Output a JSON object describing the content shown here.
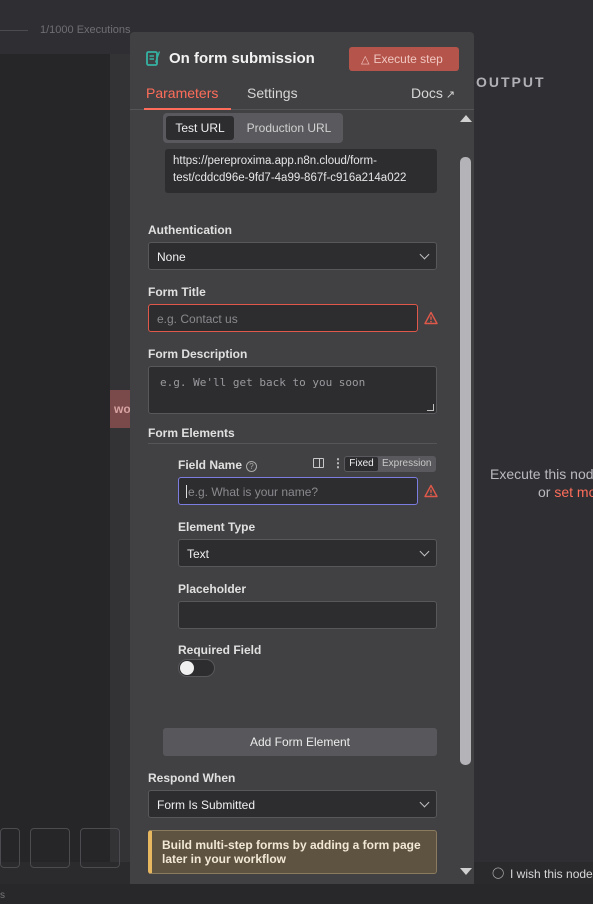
{
  "background": {
    "executions_label": "1/1000 Executions",
    "node_label": "wo",
    "output_heading": "OUTPUT",
    "execute_message_line1": "Execute this nod",
    "execute_message_or": "or ",
    "execute_message_link": "set mo",
    "wish_text": "I wish this node",
    "bottom_text": "s"
  },
  "panel": {
    "title": "On form submission",
    "execute_button": "Execute step",
    "tabs": {
      "parameters": "Parameters",
      "settings": "Settings",
      "docs": "Docs"
    },
    "url_toggle": {
      "test": "Test URL",
      "production": "Production URL"
    },
    "url": "https://pereproxima.app.n8n.cloud/form-test/cddcd96e-9fd7-4a99-867f-c916a214a022",
    "authentication": {
      "label": "Authentication",
      "value": "None"
    },
    "form_title": {
      "label": "Form Title",
      "placeholder": "e.g. Contact us"
    },
    "form_description": {
      "label": "Form Description",
      "placeholder": "e.g. We'll get back to you soon"
    },
    "form_elements": {
      "label": "Form Elements",
      "field_name": {
        "label": "Field Name",
        "placeholder": "e.g. What is your name?",
        "mode_fixed": "Fixed",
        "mode_expression": "Expression"
      },
      "element_type": {
        "label": "Element Type",
        "value": "Text"
      },
      "placeholder": {
        "label": "Placeholder",
        "value": ""
      },
      "required_field": {
        "label": "Required Field",
        "enabled": false
      },
      "add_button": "Add Form Element"
    },
    "respond_when": {
      "label": "Respond When",
      "value": "Form Is Submitted"
    },
    "notice": "Build multi-step forms by adding a form page later in your workflow"
  },
  "colors": {
    "accent": "#ff6d5a",
    "error": "#e0584a",
    "focus": "#7b7de0",
    "node_icon": "#35b3a3"
  }
}
